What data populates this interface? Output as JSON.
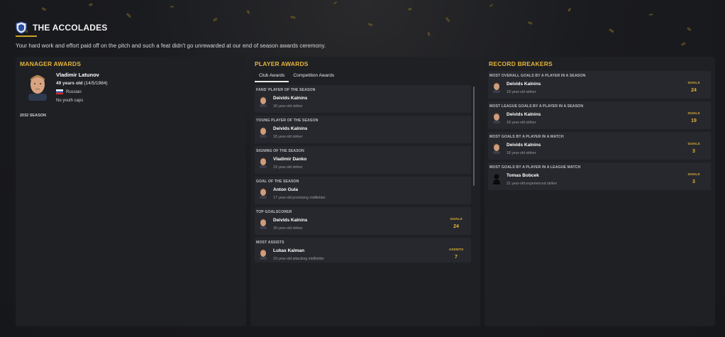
{
  "header": {
    "title": "THE ACCOLADES",
    "subtitle": "Your hard work and effort paid off on the pitch and such a feat didn't go unrewarded at our end of season awards ceremony."
  },
  "manager": {
    "panel_title": "MANAGER AWARDS",
    "name": "Vladimir Latunov",
    "age": "49 years old",
    "dob": "(14/5/1984)",
    "nationality": "Russian",
    "caps": "No youth caps",
    "season": "2032 SEASON"
  },
  "player_awards": {
    "panel_title": "PLAYER AWARDS",
    "tabs": [
      "Club Awards",
      "Competition Awards"
    ],
    "active_tab": "Club Awards",
    "items": [
      {
        "title": "FANS' PLAYER OF THE SEASON",
        "name": "Deivids Kalnins",
        "desc": "18 year-old striker",
        "stat_label": "",
        "stat_value": ""
      },
      {
        "title": "YOUNG PLAYER OF THE SEASON",
        "name": "Deivids Kalnins",
        "desc": "18 year-old striker",
        "stat_label": "",
        "stat_value": ""
      },
      {
        "title": "SIGNING OF THE SEASON",
        "name": "Vladimir Danko",
        "desc": "19 year-old striker",
        "stat_label": "",
        "stat_value": ""
      },
      {
        "title": "GOAL OF THE SEASON",
        "name": "Anton Gula",
        "desc": "17 year-old promising midfielder",
        "stat_label": "",
        "stat_value": ""
      },
      {
        "title": "TOP GOALSCORER",
        "name": "Deivids Kalnins",
        "desc": "18 year-old striker",
        "stat_label": "GOALS",
        "stat_value": "24"
      },
      {
        "title": "MOST ASSISTS",
        "name": "Lukas Kalman",
        "desc": "19 year-old attacking midfielder",
        "stat_label": "ASSISTS",
        "stat_value": "7"
      }
    ]
  },
  "records": {
    "panel_title": "RECORD BREAKERS",
    "items": [
      {
        "title": "MOST OVERALL GOALS BY A PLAYER IN A SEASON",
        "name": "Deivids Kalnins",
        "desc": "18 year-old striker",
        "stat_label": "GOALS",
        "stat_value": "24"
      },
      {
        "title": "MOST LEAGUE GOALS BY A PLAYER IN A SEASON",
        "name": "Deivids Kalnins",
        "desc": "18 year-old striker",
        "stat_label": "GOALS",
        "stat_value": "19"
      },
      {
        "title": "MOST GOALS BY A PLAYER IN A MATCH",
        "name": "Deivids Kalnins",
        "desc": "18 year-old striker",
        "stat_label": "GOALS",
        "stat_value": "3"
      },
      {
        "title": "MOST GOALS BY A PLAYER IN A LEAGUE MATCH",
        "name": "Tomas Bobcek",
        "desc": "31 year-old experienced striker",
        "stat_label": "GOALS",
        "stat_value": "3"
      }
    ]
  },
  "colors": {
    "accent": "#e3b43a",
    "panel": "#1f2024",
    "card": "#27282d"
  }
}
